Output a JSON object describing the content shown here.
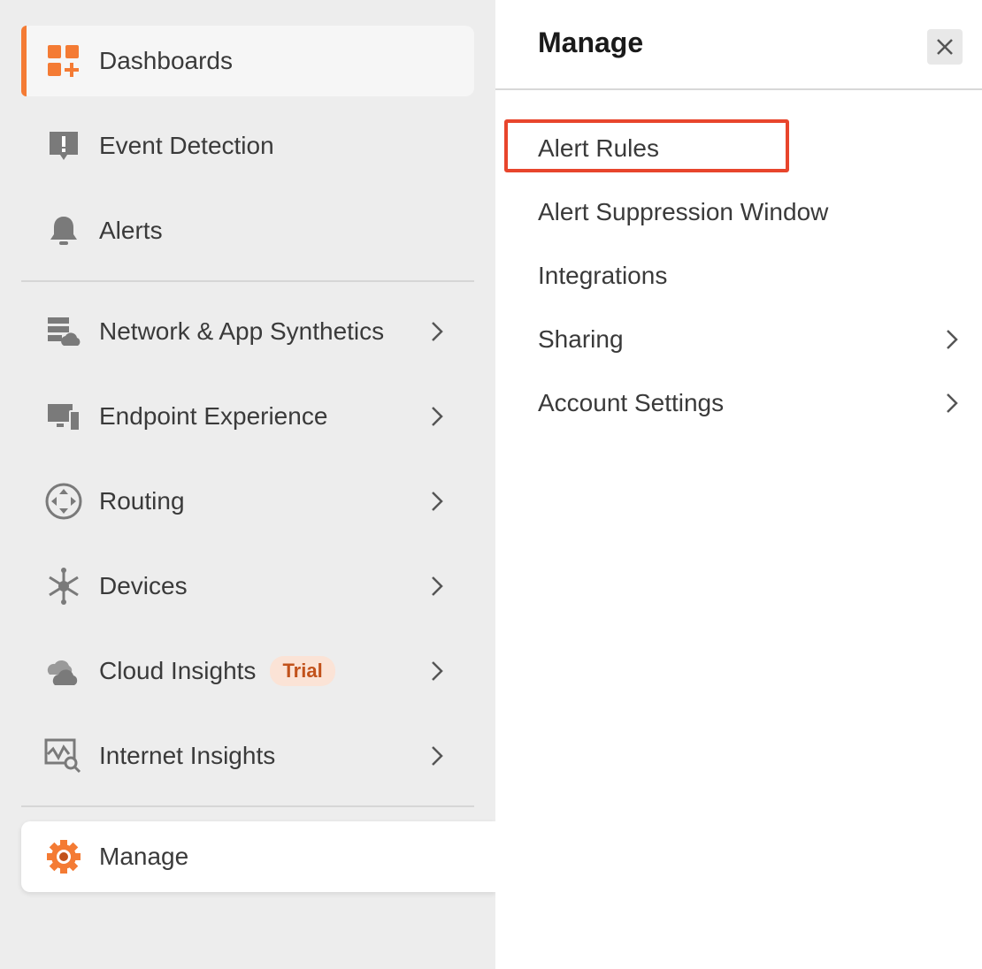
{
  "sidebar": {
    "items": [
      {
        "label": "Dashboards",
        "icon": "dashboard-add-icon"
      },
      {
        "label": "Event Detection",
        "icon": "event-alert-icon"
      },
      {
        "label": "Alerts",
        "icon": "bell-icon"
      },
      {
        "label": "Network & App Synthetics",
        "icon": "server-cloud-icon"
      },
      {
        "label": "Endpoint Experience",
        "icon": "monitor-device-icon"
      },
      {
        "label": "Routing",
        "icon": "routing-icon"
      },
      {
        "label": "Devices",
        "icon": "network-hub-icon"
      },
      {
        "label": "Cloud Insights",
        "icon": "cloud-icon",
        "badge": "Trial"
      },
      {
        "label": "Internet Insights",
        "icon": "internet-search-icon"
      },
      {
        "label": "Manage",
        "icon": "gear-icon"
      }
    ]
  },
  "panel": {
    "title": "Manage",
    "items": [
      {
        "label": "Alert Rules"
      },
      {
        "label": "Alert Suppression Window"
      },
      {
        "label": "Integrations"
      },
      {
        "label": "Sharing"
      },
      {
        "label": "Account Settings"
      }
    ]
  },
  "colors": {
    "accent": "#f47b34",
    "highlight": "#e8452c",
    "badge_bg": "#fbe3d6",
    "badge_text": "#c2521b",
    "sidebar_bg": "#ededed"
  }
}
